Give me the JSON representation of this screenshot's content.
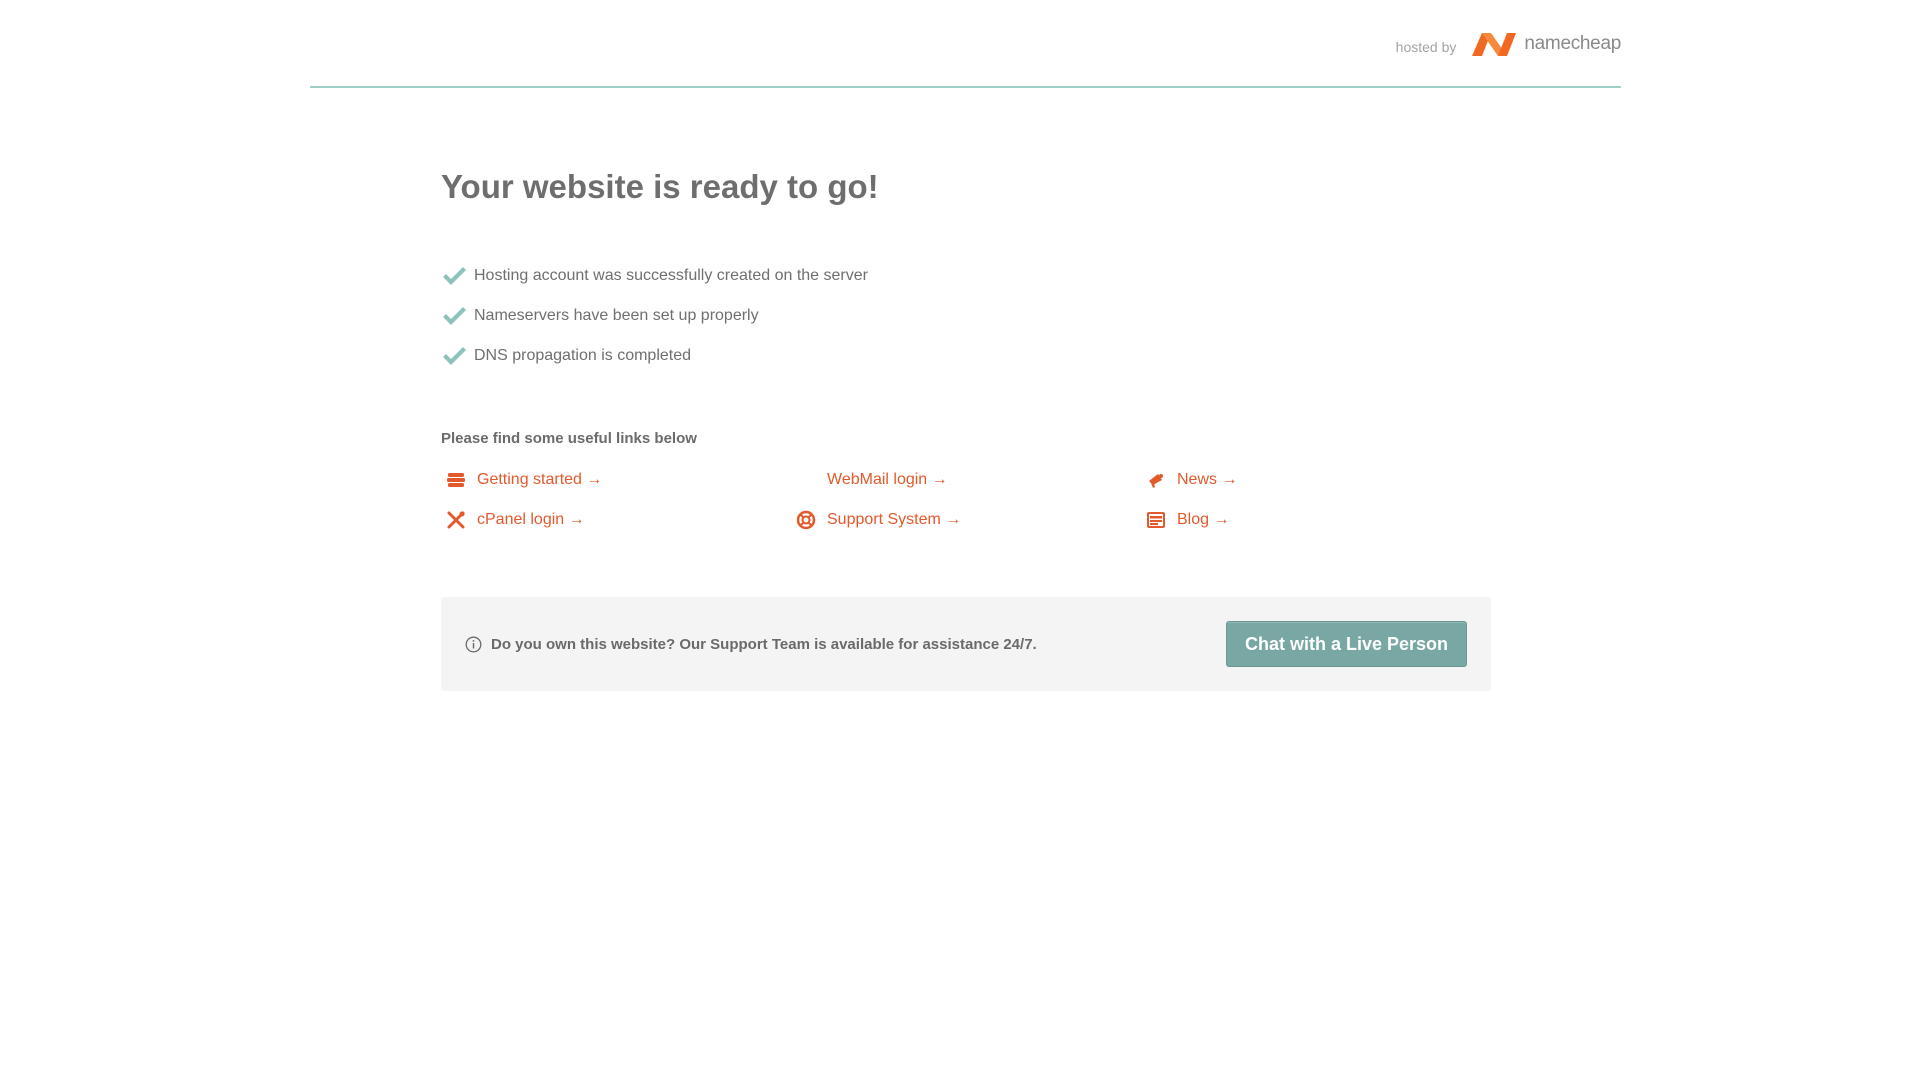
{
  "header": {
    "hosted_by": "hosted by",
    "brand_name": "namecheap",
    "line_color": "#9fcfc6",
    "brand_color": "#f26722"
  },
  "main": {
    "title": "Your website is ready to go!",
    "checks": [
      "Hosting account was successfully created on the server",
      "Nameservers have been set up properly",
      "DNS propagation is completed"
    ],
    "check_color": "#8ec2bb"
  },
  "links": {
    "title": "Please find some useful links below",
    "link_color": "#e25a2c",
    "items": [
      {
        "label": "Getting started →",
        "icon": "stack-icon"
      },
      {
        "label": "cPanel login →",
        "icon": "tools-icon"
      },
      {
        "label": "WebMail login →",
        "icon": "mail-icon"
      },
      {
        "label": "Support System →",
        "icon": "lifebuoy-icon"
      },
      {
        "label": "News →",
        "icon": "megaphone-icon"
      },
      {
        "label": "Blog →",
        "icon": "blog-icon"
      }
    ]
  },
  "support": {
    "text": "Do you own this website? Our Support Team is available for assistance 24/7.",
    "button_label": "Chat with a Live Person",
    "button_color": "#79a7a3"
  }
}
